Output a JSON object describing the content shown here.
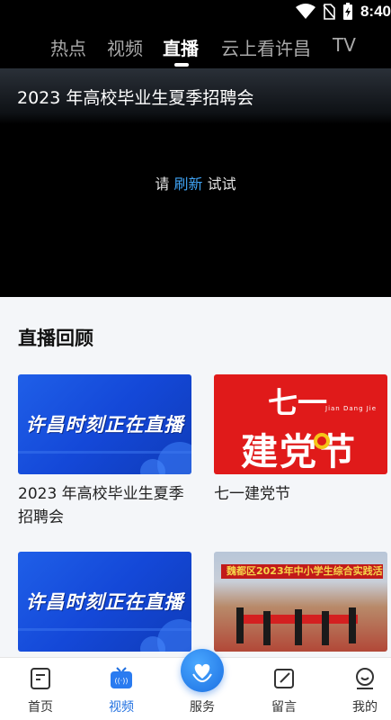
{
  "status_bar": {
    "time": "8:40"
  },
  "tabs": [
    {
      "label": "热点",
      "active": false
    },
    {
      "label": "视频",
      "active": false
    },
    {
      "label": "直播",
      "active": true
    },
    {
      "label": "云上看许昌",
      "active": false
    },
    {
      "label": "TV",
      "active": false
    }
  ],
  "player": {
    "title": "2023 年高校毕业生夏季招聘会",
    "message_prefix": "请 ",
    "message_link": "刷新",
    "message_suffix": " 试试"
  },
  "replay": {
    "title": "直播回顾",
    "cards": [
      {
        "title": "2023 年高校毕业生夏季招聘会",
        "thumb_text": "许昌时刻正在直播"
      },
      {
        "title": "七一建党节",
        "thumb_big1": "七一",
        "thumb_big2": "建党节",
        "thumb_pinyin": "Jian Dang Jie"
      },
      {
        "title": "",
        "thumb_text": "许昌时刻正在直播"
      },
      {
        "title": "",
        "thumb_banner": "魏都区2023年中小学生综合实践活动"
      }
    ]
  },
  "bottom_nav": {
    "items": [
      {
        "label": "首页",
        "icon": "home-doc-icon",
        "active": false
      },
      {
        "label": "视频",
        "icon": "tv-icon",
        "active": true
      },
      {
        "label": "服务",
        "icon": "heart-hands-icon",
        "active": false
      },
      {
        "label": "留言",
        "icon": "edit-icon",
        "active": false
      },
      {
        "label": "我的",
        "icon": "user-icon",
        "active": false
      }
    ]
  },
  "colors": {
    "accent": "#1f6fe0",
    "link": "#3fa3f5",
    "red_thumb": "#e01a1a"
  }
}
